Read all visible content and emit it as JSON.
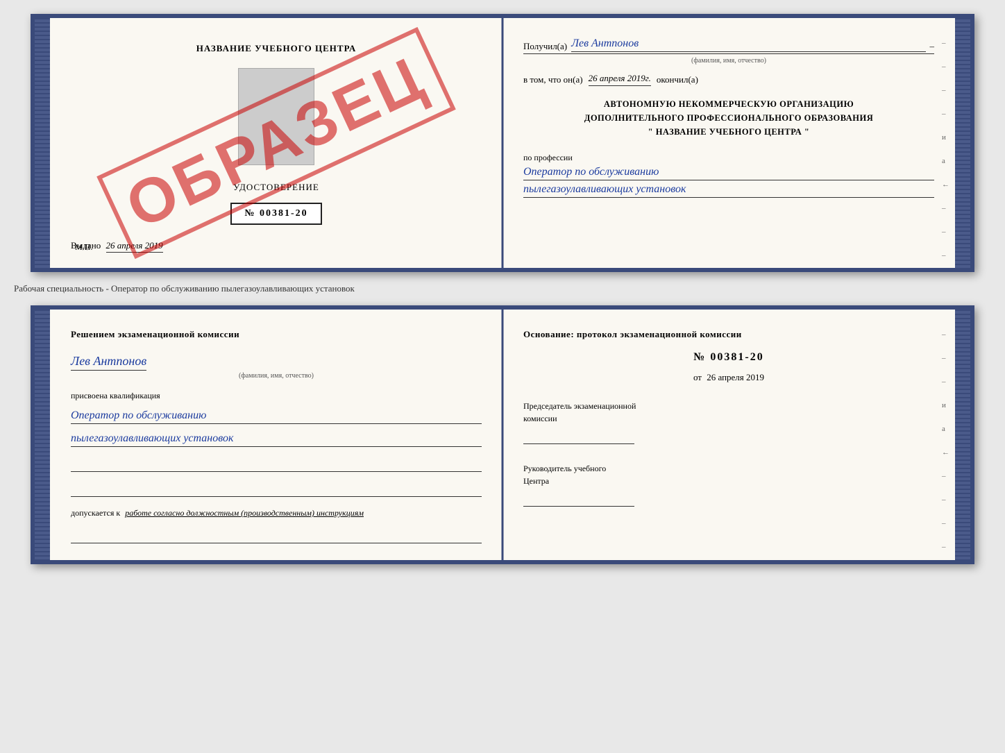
{
  "top": {
    "left": {
      "center_title": "НАЗВАНИЕ УЧЕБНОГО ЦЕНТРА",
      "udostoverenie_label": "УДОСТОВЕРЕНИЕ",
      "cert_number": "№ 00381-20",
      "issued_prefix": "Выдано",
      "issued_date": "26 апреля 2019",
      "mp_label": "М.П.",
      "obrazets": "ОБРАЗЕЦ"
    },
    "right": {
      "recipient_label": "Получил(а)",
      "recipient_name": "Лев Антпонов",
      "fio_hint": "(фамилия, имя, отчество)",
      "date_prefix": "в том, что он(а)",
      "date_value": "26 апреля 2019г.",
      "date_suffix": "окончил(а)",
      "org_line1": "АВТОНОМНУЮ НЕКОММЕРЧЕСКУЮ ОРГАНИЗАЦИЮ",
      "org_line2": "ДОПОЛНИТЕЛЬНОГО ПРОФЕССИОНАЛЬНОГО ОБРАЗОВАНИЯ",
      "org_name_open": "\"",
      "org_name": "НАЗВАНИЕ УЧЕБНОГО ЦЕНТРА",
      "org_name_close": "\"",
      "profession_label": "по профессии",
      "profession_value1": "Оператор по обслуживанию",
      "profession_value2": "пылегазоулавливающих установок"
    }
  },
  "separator": {
    "text": "Рабочая специальность - Оператор по обслуживанию пылегазоулавливающих установок"
  },
  "bottom": {
    "left": {
      "commission_title": "Решением экзаменационной комиссии",
      "name": "Лев Антпонов",
      "fio_hint": "(фамилия, имя, отчество)",
      "qualification_label": "присвоена квалификация",
      "qualification1": "Оператор по обслуживанию",
      "qualification2": "пылегазоулавливающих установок",
      "допускается_label": "допускается к",
      "допускается_value": "работе согласно должностным (производственным) инструкциям"
    },
    "right": {
      "osnov_label": "Основание: протокол экзаменационной комиссии",
      "protocol_number": "№ 00381-20",
      "protocol_date_prefix": "от",
      "protocol_date": "26 апреля 2019",
      "chairman_label": "Председатель экзаменационной",
      "chairman_label2": "комиссии",
      "rukovod_label": "Руководитель учебного",
      "rukovod_label2": "Центра"
    }
  },
  "right_margin_dashes": [
    "-",
    "-",
    "-",
    "-",
    "и",
    "а",
    "←",
    "-",
    "-",
    "-",
    "-"
  ]
}
